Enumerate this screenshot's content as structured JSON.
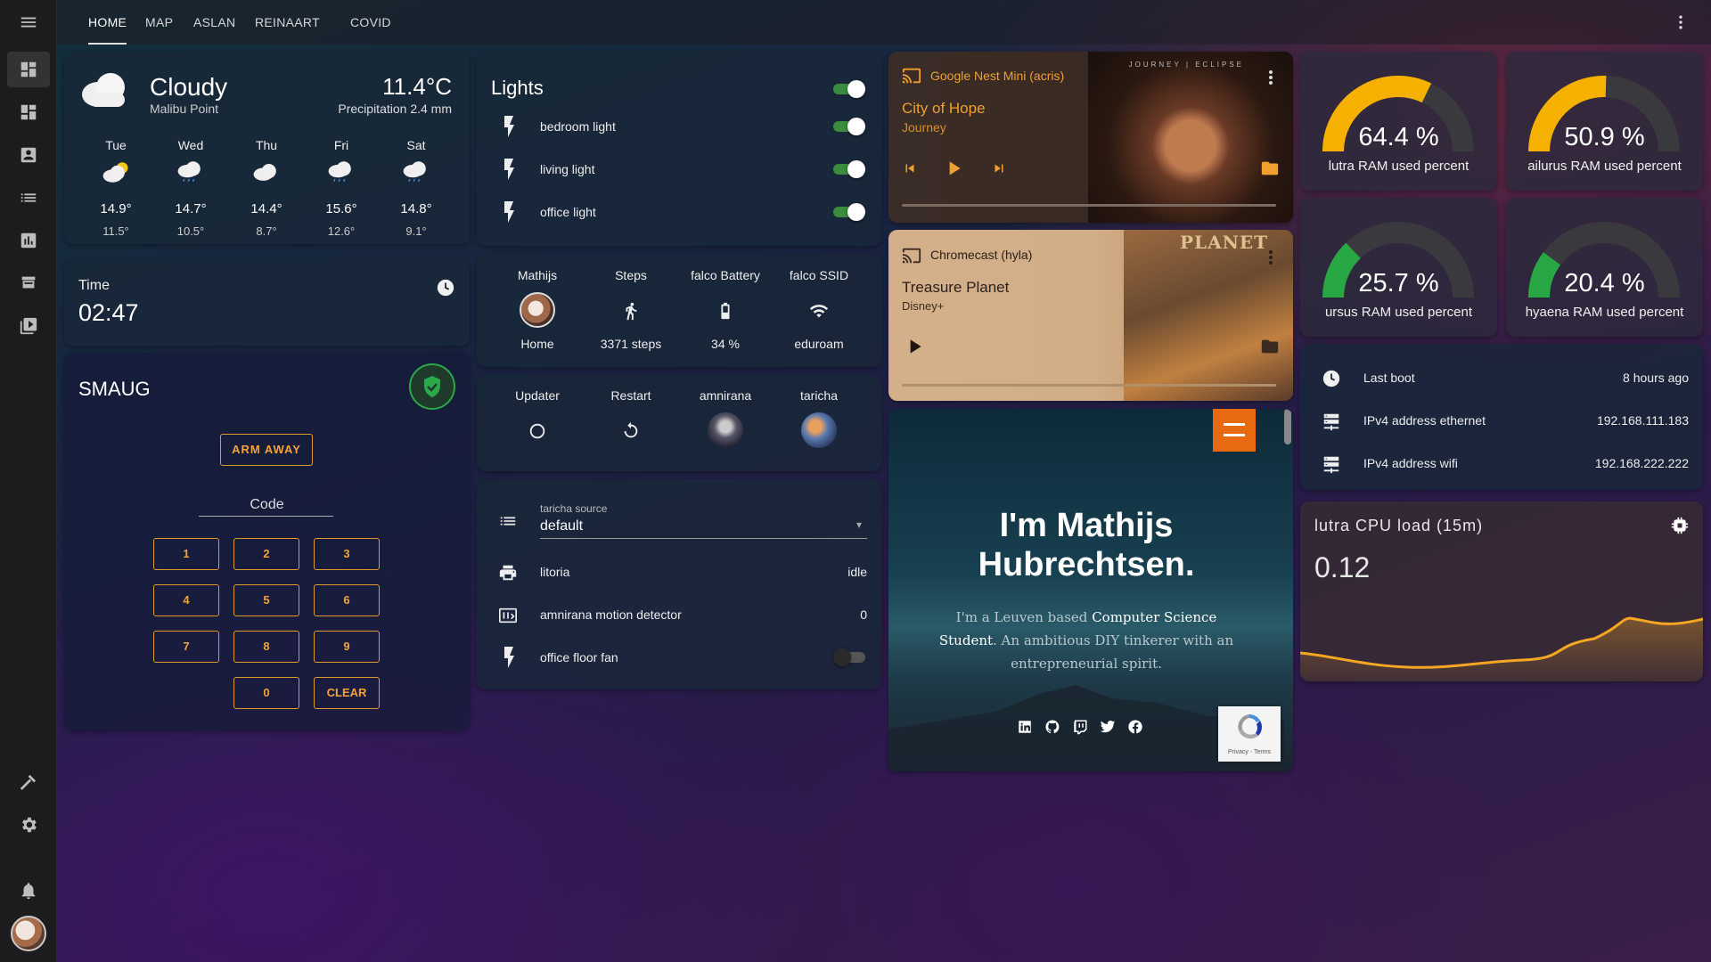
{
  "nav": {
    "tabs": [
      "HOME",
      "MAP",
      "ASLAN",
      "REINAART",
      "COVID"
    ],
    "active_tab": "HOME"
  },
  "sidebar": {
    "items": [
      "menu-icon",
      "dashboard-icon",
      "dashboard-alt-icon",
      "account-box-icon",
      "list-icon",
      "chart-icon",
      "hacs-icon",
      "media-icon",
      "hammer-icon",
      "gear-icon",
      "bell-icon"
    ]
  },
  "weather": {
    "condition": "Cloudy",
    "location": "Malibu Point",
    "temperature": "11.4°C",
    "precipitation": "Precipitation 2.4 mm",
    "forecast": [
      {
        "day": "Tue",
        "high": "14.9°",
        "low": "11.5°",
        "icon": "partly-cloudy-icon"
      },
      {
        "day": "Wed",
        "high": "14.7°",
        "low": "10.5°",
        "icon": "rainy-icon"
      },
      {
        "day": "Thu",
        "high": "14.4°",
        "low": "8.7°",
        "icon": "cloudy-icon"
      },
      {
        "day": "Fri",
        "high": "15.6°",
        "low": "12.6°",
        "icon": "rainy-icon"
      },
      {
        "day": "Sat",
        "high": "14.8°",
        "low": "9.1°",
        "icon": "rainy-icon"
      }
    ]
  },
  "time": {
    "label": "Time",
    "value": "02:47"
  },
  "alarm": {
    "name": "SMAUG",
    "arm_away": "ARM AWAY",
    "code_label": "Code",
    "keys": [
      "1",
      "2",
      "3",
      "4",
      "5",
      "6",
      "7",
      "8",
      "9",
      "0",
      "CLEAR"
    ]
  },
  "lights": {
    "title": "Lights",
    "items": [
      {
        "name": "bedroom light",
        "on": true
      },
      {
        "name": "living light",
        "on": true
      },
      {
        "name": "office light",
        "on": true
      }
    ]
  },
  "glance1": {
    "items": [
      {
        "name": "Mathijs",
        "state": "Home"
      },
      {
        "name": "Steps",
        "state": "3371 steps"
      },
      {
        "name": "falco Battery",
        "state": "34 %"
      },
      {
        "name": "falco SSID",
        "state": "eduroam"
      }
    ]
  },
  "glance2": {
    "items": [
      {
        "name": "Updater"
      },
      {
        "name": "Restart"
      },
      {
        "name": "amnirana"
      },
      {
        "name": "taricha"
      }
    ]
  },
  "entities": {
    "source_label": "taricha source",
    "source_value": "default",
    "rows": [
      {
        "name": "litoria",
        "state": "idle"
      },
      {
        "name": "amnirana motion detector",
        "state": "0"
      },
      {
        "name": "office floor fan",
        "state": ""
      }
    ]
  },
  "media1": {
    "device": "Google Nest Mini (acris)",
    "title": "City of Hope",
    "artist": "Journey",
    "art_text": "JOURNEY | ECLIPSE"
  },
  "media2": {
    "device": "Chromecast (hyla)",
    "title": "Treasure Planet",
    "artist": "Disney+",
    "art_text": "PLANET"
  },
  "website": {
    "heading_line1": "I'm Mathijs",
    "heading_line2": "Hubrechtsen.",
    "intro_a": "I'm a Leuven based ",
    "intro_b": "Computer Science",
    "intro_c": "Student",
    "intro_d": ". An ambitious DIY tinkerer with an",
    "intro_e": "entrepreneurial spirit.",
    "recaptcha": "Privacy - Terms"
  },
  "gauges": [
    {
      "value": "64.4 %",
      "label": "lutra RAM used percent",
      "fraction": 0.644,
      "color": "#f5b000"
    },
    {
      "value": "50.9 %",
      "label": "ailurus RAM used percent",
      "fraction": 0.509,
      "color": "#f5b000"
    },
    {
      "value": "25.7 %",
      "label": "ursus RAM used percent",
      "fraction": 0.257,
      "color": "#28a745"
    },
    {
      "value": "20.4 %",
      "label": "hyaena RAM used percent",
      "fraction": 0.204,
      "color": "#28a745"
    }
  ],
  "info": {
    "rows": [
      {
        "name": "Last boot",
        "state": "8 hours ago"
      },
      {
        "name": "IPv4 address ethernet",
        "state": "192.168.111.183"
      },
      {
        "name": "IPv4 address wifi",
        "state": "192.168.222.222"
      }
    ]
  },
  "cpu": {
    "title": "lutra CPU load (15m)",
    "value": "0.12"
  }
}
